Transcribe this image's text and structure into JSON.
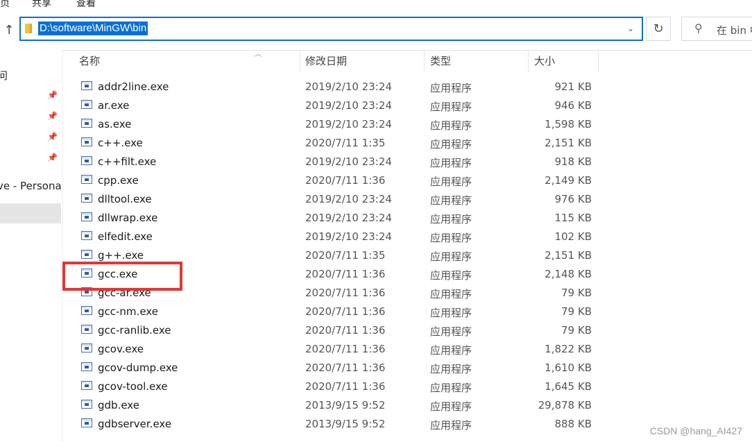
{
  "ribbon": {
    "tab1": "页",
    "tab2": "共享",
    "tab3": "查看"
  },
  "address": {
    "path": "D:\\software\\MinGW\\bin"
  },
  "search": {
    "placeholder": "在 bin 中"
  },
  "icons": {
    "up": "up-arrow-icon",
    "refresh": "refresh-icon",
    "search": "search-icon",
    "dropdown": "chevron-down-icon",
    "pin": "pin-icon",
    "folder": "folder-icon",
    "file": "application-icon"
  },
  "nav": {
    "item_top": "问",
    "item_onedrive": "ve - Persona"
  },
  "columns": {
    "name": "名称",
    "date": "修改日期",
    "type": "类型",
    "size": "大小"
  },
  "files": [
    {
      "name": "addr2line.exe",
      "date": "2019/2/10 23:24",
      "type": "应用程序",
      "size": "921 KB"
    },
    {
      "name": "ar.exe",
      "date": "2019/2/10 23:24",
      "type": "应用程序",
      "size": "946 KB"
    },
    {
      "name": "as.exe",
      "date": "2019/2/10 23:24",
      "type": "应用程序",
      "size": "1,598 KB"
    },
    {
      "name": "c++.exe",
      "date": "2020/7/11 1:35",
      "type": "应用程序",
      "size": "2,151 KB"
    },
    {
      "name": "c++filt.exe",
      "date": "2019/2/10 23:24",
      "type": "应用程序",
      "size": "918 KB"
    },
    {
      "name": "cpp.exe",
      "date": "2020/7/11 1:36",
      "type": "应用程序",
      "size": "2,149 KB"
    },
    {
      "name": "dlltool.exe",
      "date": "2019/2/10 23:24",
      "type": "应用程序",
      "size": "976 KB"
    },
    {
      "name": "dllwrap.exe",
      "date": "2019/2/10 23:24",
      "type": "应用程序",
      "size": "115 KB"
    },
    {
      "name": "elfedit.exe",
      "date": "2019/2/10 23:24",
      "type": "应用程序",
      "size": "102 KB"
    },
    {
      "name": "g++.exe",
      "date": "2020/7/11 1:35",
      "type": "应用程序",
      "size": "2,151 KB"
    },
    {
      "name": "gcc.exe",
      "date": "2020/7/11 1:36",
      "type": "应用程序",
      "size": "2,148 KB"
    },
    {
      "name": "gcc-ar.exe",
      "date": "2020/7/11 1:36",
      "type": "应用程序",
      "size": "79 KB"
    },
    {
      "name": "gcc-nm.exe",
      "date": "2020/7/11 1:36",
      "type": "应用程序",
      "size": "79 KB"
    },
    {
      "name": "gcc-ranlib.exe",
      "date": "2020/7/11 1:36",
      "type": "应用程序",
      "size": "79 KB"
    },
    {
      "name": "gcov.exe",
      "date": "2020/7/11 1:36",
      "type": "应用程序",
      "size": "1,822 KB"
    },
    {
      "name": "gcov-dump.exe",
      "date": "2020/7/11 1:36",
      "type": "应用程序",
      "size": "1,610 KB"
    },
    {
      "name": "gcov-tool.exe",
      "date": "2020/7/11 1:36",
      "type": "应用程序",
      "size": "1,645 KB"
    },
    {
      "name": "gdb.exe",
      "date": "2013/9/15 9:52",
      "type": "应用程序",
      "size": "29,878 KB"
    },
    {
      "name": "gdbserver.exe",
      "date": "2013/9/15 9:52",
      "type": "应用程序",
      "size": "888 KB"
    }
  ],
  "watermark": "CSDN @hang_AI427",
  "accent": "#0a70d6",
  "highlight_color": "#e63535"
}
